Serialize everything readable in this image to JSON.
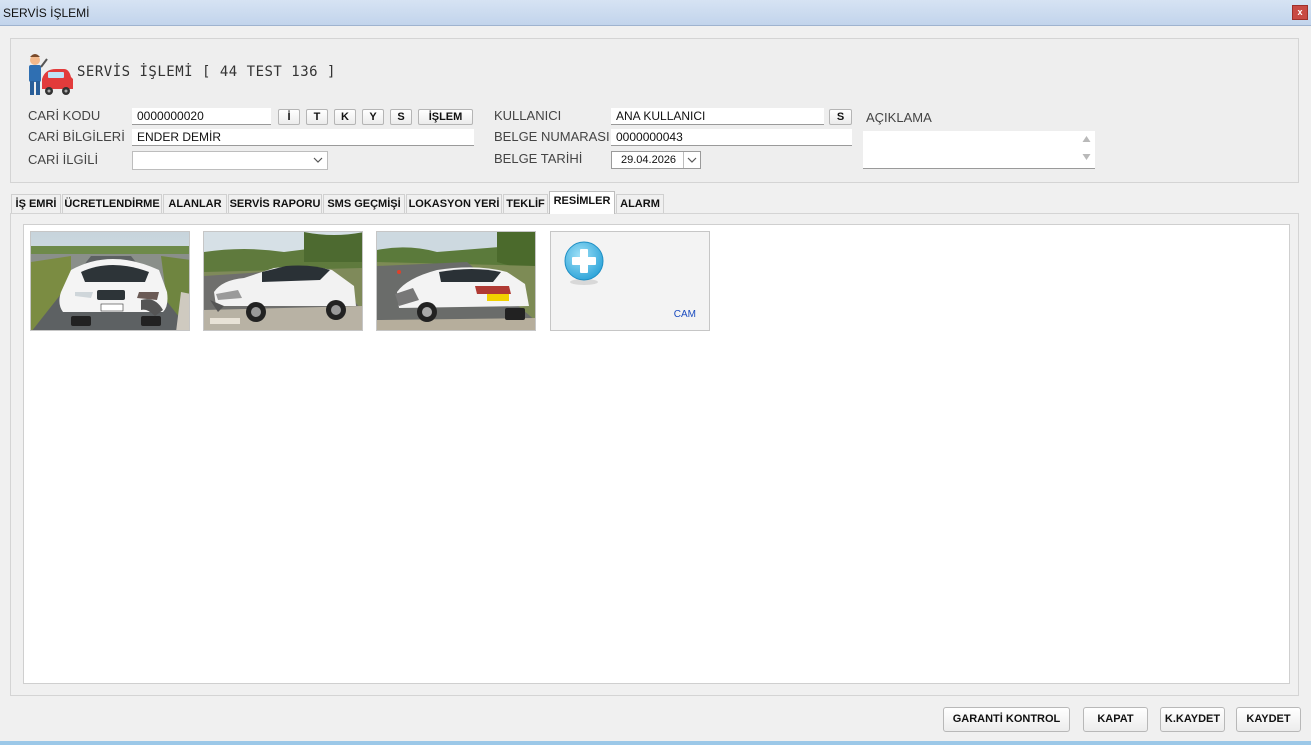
{
  "window": {
    "title": "SERVİS İŞLEMİ",
    "close_label": "x"
  },
  "header": {
    "title": "SERVİS İŞLEMİ [ 44 TEST 136 ]"
  },
  "form": {
    "cari_kodu_label": "CARİ KODU",
    "cari_kodu_value": "0000000020",
    "cari_bilgileri_label": "CARİ BİLGİLERİ",
    "cari_bilgileri_value": "ENDER DEMİR",
    "cari_ilgili_label": "CARİ İLGİLİ",
    "cari_ilgili_value": "",
    "kullanici_label": "KULLANICI",
    "kullanici_value": "ANA KULLANICI",
    "belge_numarasi_label": "BELGE NUMARASI",
    "belge_numarasi_value": "0000000043",
    "belge_tarihi_label": "BELGE TARİHİ",
    "belge_tarihi_value": "29.04.2026",
    "aciklama_label": "AÇIKLAMA",
    "aciklama_value": ""
  },
  "shortcut_buttons": [
    "İ",
    "T",
    "K",
    "Y",
    "S",
    "İŞLEM"
  ],
  "kullanici_button": "S",
  "tabs": [
    {
      "label": "İŞ EMRİ",
      "active": false
    },
    {
      "label": "ÜCRETLENDİRME",
      "active": false
    },
    {
      "label": "ALANLAR",
      "active": false
    },
    {
      "label": "SERVİS RAPORU",
      "active": false
    },
    {
      "label": "SMS GEÇMİŞİ",
      "active": false
    },
    {
      "label": "LOKASYON YERİ",
      "active": false
    },
    {
      "label": "TEKLİF",
      "active": false
    },
    {
      "label": "RESİMLER",
      "active": true
    },
    {
      "label": "ALARM",
      "active": false
    }
  ],
  "gallery": {
    "photos": [
      "damaged-car-front",
      "damaged-car-side",
      "damaged-car-rear"
    ],
    "add_label": "CAM",
    "add_icon": "plus-circle-icon"
  },
  "footer": {
    "garanti_label": "GARANTİ KONTROL",
    "kapat_label": "KAPAT",
    "kkaydet_label": "K.KAYDET",
    "kaydet_label": "KAYDET"
  },
  "colors": {
    "accent": "#1a4bbf",
    "titlebar": "#c9d9ef",
    "close": "#c84a44"
  }
}
